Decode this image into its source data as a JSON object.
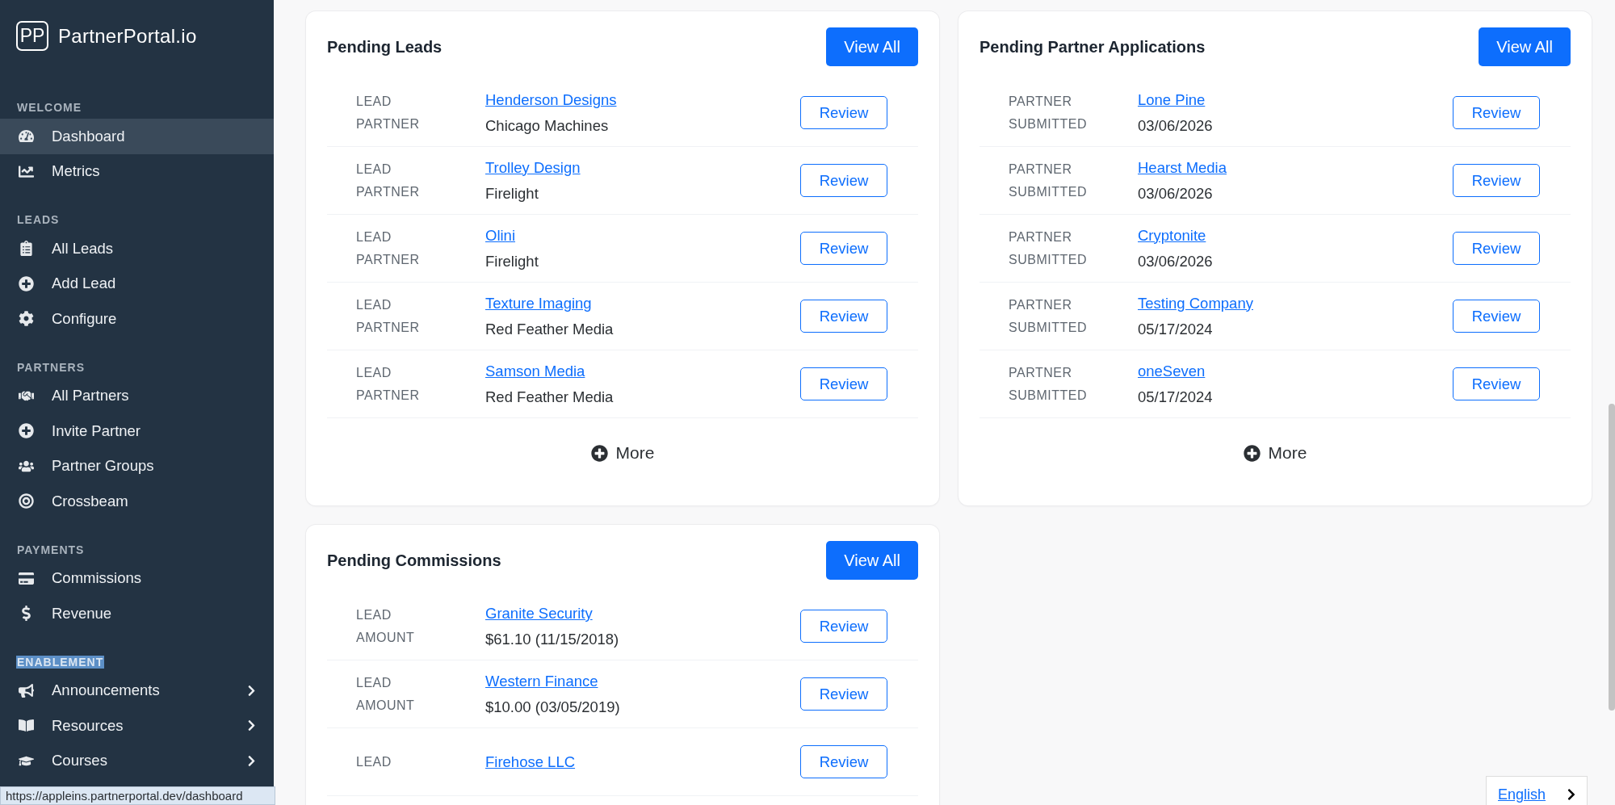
{
  "brand": {
    "logo_text": "PP",
    "name": "PartnerPortal.io"
  },
  "sidebar": {
    "sections": [
      {
        "title": "WELCOME",
        "text_selected": false,
        "items": [
          {
            "label": "Dashboard",
            "selected": true,
            "expandable": false
          },
          {
            "label": "Metrics",
            "selected": false,
            "expandable": false
          }
        ]
      },
      {
        "title": "LEADS",
        "text_selected": false,
        "items": [
          {
            "label": "All Leads",
            "selected": false,
            "expandable": false
          },
          {
            "label": "Add Lead",
            "selected": false,
            "expandable": false
          },
          {
            "label": "Configure",
            "selected": false,
            "expandable": false
          }
        ]
      },
      {
        "title": "PARTNERS",
        "text_selected": false,
        "items": [
          {
            "label": "All Partners",
            "selected": false,
            "expandable": false
          },
          {
            "label": "Invite Partner",
            "selected": false,
            "expandable": false
          },
          {
            "label": "Partner Groups",
            "selected": false,
            "expandable": false
          },
          {
            "label": "Crossbeam",
            "selected": false,
            "expandable": false
          }
        ]
      },
      {
        "title": "PAYMENTS",
        "text_selected": false,
        "items": [
          {
            "label": "Commissions",
            "selected": false,
            "expandable": false
          },
          {
            "label": "Revenue",
            "selected": false,
            "expandable": false
          }
        ]
      },
      {
        "title": "ENABLEMENT",
        "text_selected": true,
        "items": [
          {
            "label": "Announcements",
            "selected": false,
            "expandable": true
          },
          {
            "label": "Resources",
            "selected": false,
            "expandable": true
          },
          {
            "label": "Courses",
            "selected": false,
            "expandable": true
          }
        ]
      }
    ]
  },
  "cards": [
    {
      "title": "Pending Leads",
      "button": "View All",
      "more": "More",
      "rows": [
        {
          "label_1": "LEAD",
          "link": "Henderson Designs",
          "label_2": "PARTNER",
          "value": "Chicago Machines",
          "action": "Review"
        },
        {
          "label_1": "LEAD",
          "link": "Trolley Design",
          "label_2": "PARTNER",
          "value": "Firelight",
          "action": "Review"
        },
        {
          "label_1": "LEAD",
          "link": "Olini",
          "label_2": "PARTNER",
          "value": "Firelight",
          "action": "Review"
        },
        {
          "label_1": "LEAD",
          "link": "Texture Imaging",
          "label_2": "PARTNER",
          "value": "Red Feather Media",
          "action": "Review"
        },
        {
          "label_1": "LEAD",
          "link": "Samson Media",
          "label_2": "PARTNER",
          "value": "Red Feather Media",
          "action": "Review"
        }
      ]
    },
    {
      "title": "Pending Partner Applications",
      "button": "View All",
      "more": "More",
      "rows": [
        {
          "label_1": "PARTNER",
          "link": "Lone Pine",
          "label_2": "SUBMITTED",
          "value": "03/06/2026",
          "action": "Review"
        },
        {
          "label_1": "PARTNER",
          "link": "Hearst Media",
          "label_2": "SUBMITTED",
          "value": "03/06/2026",
          "action": "Review"
        },
        {
          "label_1": "PARTNER",
          "link": "Cryptonite",
          "label_2": "SUBMITTED",
          "value": "03/06/2026",
          "action": "Review"
        },
        {
          "label_1": "PARTNER",
          "link": "Testing Company",
          "label_2": "SUBMITTED",
          "value": "05/17/2024",
          "action": "Review"
        },
        {
          "label_1": "PARTNER",
          "link": "oneSeven",
          "label_2": "SUBMITTED",
          "value": "05/17/2024",
          "action": "Review"
        }
      ]
    },
    {
      "title": "Pending Commissions",
      "button": "View All",
      "rows": [
        {
          "label_1": "LEAD",
          "link": "Granite Security",
          "label_2": "AMOUNT",
          "value": "$61.10 (11/15/2018)",
          "action": "Review"
        },
        {
          "label_1": "LEAD",
          "link": "Western Finance",
          "label_2": "AMOUNT",
          "value": "$10.00 (03/05/2019)",
          "action": "Review"
        },
        {
          "label_1": "LEAD",
          "link": "Firehose LLC",
          "action": "Review"
        }
      ]
    }
  ],
  "status_url": "https://appleins.partnerportal.dev/dashboard",
  "language": {
    "label": "English"
  }
}
